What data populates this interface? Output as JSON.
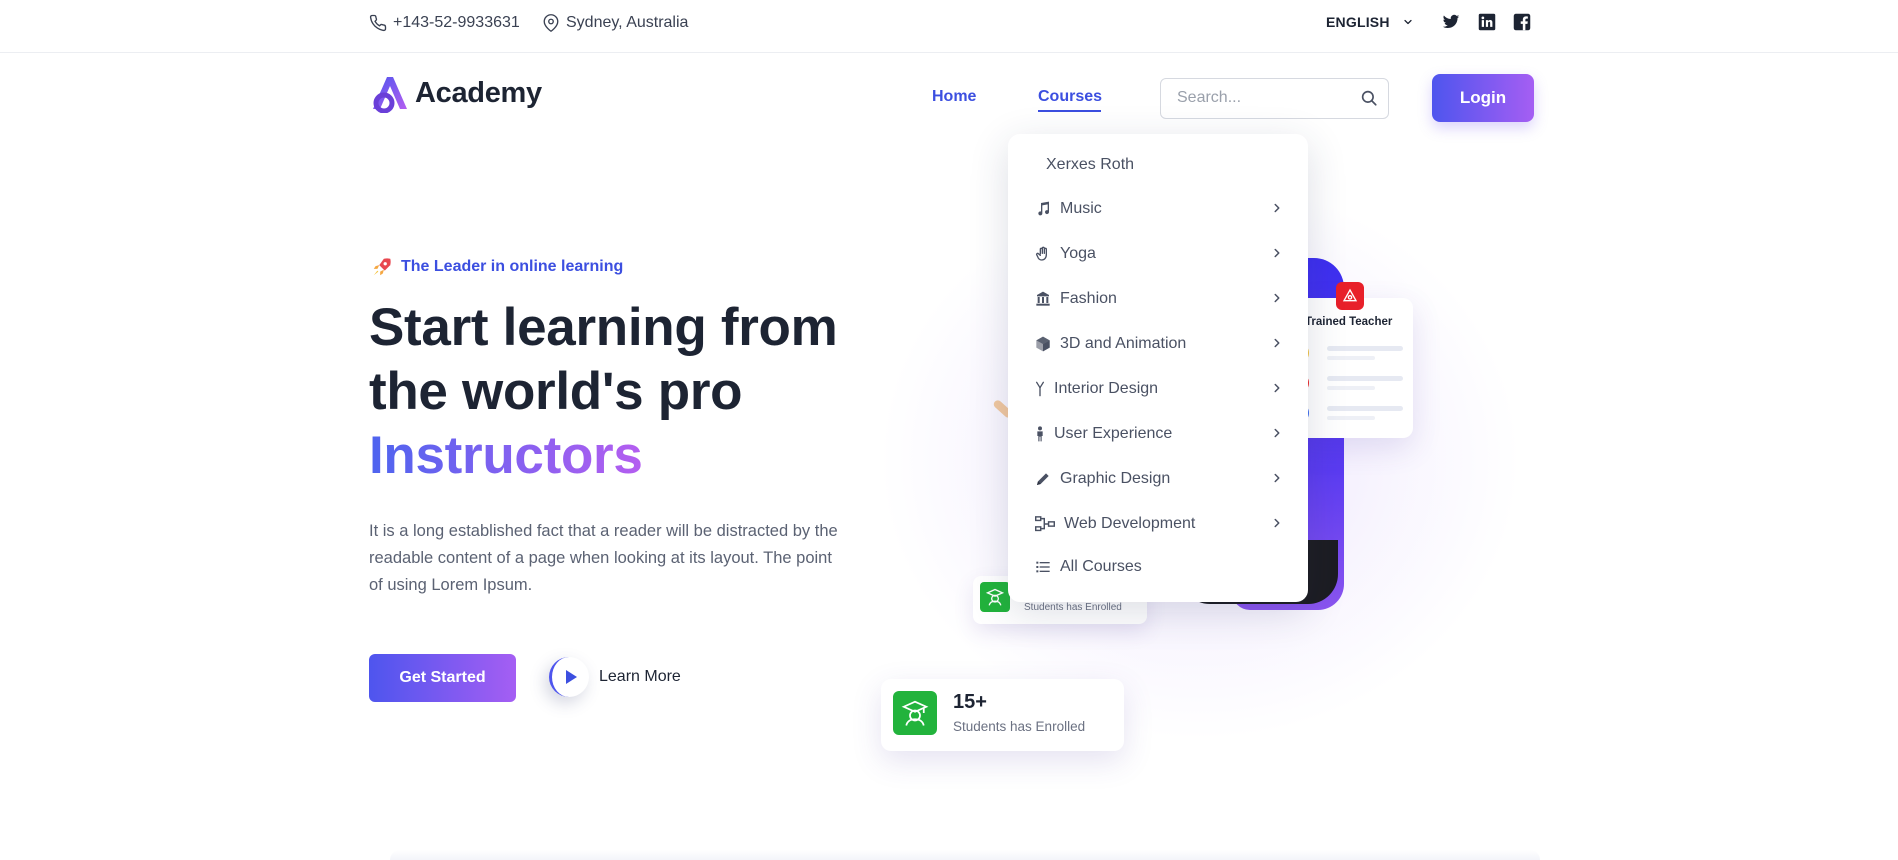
{
  "topbar": {
    "phone": "+143-52-9933631",
    "location": "Sydney, Australia",
    "language": "ENGLISH",
    "social": [
      "twitter-icon",
      "linkedin-icon",
      "facebook-icon"
    ]
  },
  "header": {
    "logo_text": "Academy",
    "nav": {
      "home": "Home",
      "courses": "Courses"
    },
    "search_placeholder": "Search...",
    "login_label": "Login"
  },
  "dropdown": {
    "header": "Xerxes Roth",
    "items": [
      {
        "label": "Music",
        "icon": "music-note-icon",
        "has_submenu": true
      },
      {
        "label": "Yoga",
        "icon": "hand-icon",
        "has_submenu": true
      },
      {
        "label": "Fashion",
        "icon": "building-icon",
        "has_submenu": true
      },
      {
        "label": "3D and Animation",
        "icon": "cube-icon",
        "has_submenu": true
      },
      {
        "label": "Interior Design",
        "icon": "lamp-icon",
        "has_submenu": true
      },
      {
        "label": "User Experience",
        "icon": "person-icon",
        "has_submenu": true
      },
      {
        "label": "Graphic Design",
        "icon": "pencil-icon",
        "has_submenu": true
      },
      {
        "label": "Web Development",
        "icon": "sitemap-icon",
        "has_submenu": true
      },
      {
        "label": "All Courses",
        "icon": "list-icon",
        "has_submenu": false
      }
    ]
  },
  "hero": {
    "tagline": "The Leader in online learning",
    "title_line1": "Start learning from",
    "title_line2": "the world's pro",
    "title_highlight": "Instructors",
    "description": "It is a long established fact that a reader will be distracted by the readable content of a page when looking at its layout. The point of using Lorem Ipsum.",
    "cta_primary": "Get Started",
    "cta_secondary": "Learn More"
  },
  "illustration": {
    "teacher_card_label": "Trained Teacher",
    "enroll_small_text": "Students has Enrolled",
    "enroll_count": "15+",
    "enroll_text": "Students has Enrolled"
  },
  "colors": {
    "accent": "#3c4fe0",
    "gradient_start": "#4e55ee",
    "gradient_end": "#a55ef3",
    "success": "#22b33c",
    "danger": "#e8202a",
    "text_dark": "#1d2433"
  }
}
